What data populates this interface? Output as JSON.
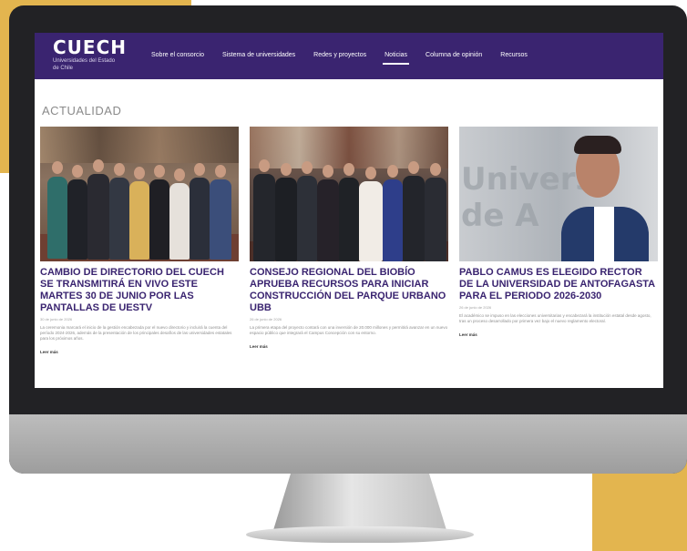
{
  "nav": {
    "logo": "CUECH",
    "logo_subtitle": "Universidades del Estado de Chile",
    "items": [
      {
        "label": "Sobre el consorcio"
      },
      {
        "label": "Sistema de universidades"
      },
      {
        "label": "Redes y proyectos"
      },
      {
        "label": "Noticias"
      },
      {
        "label": "Columna de opinión"
      },
      {
        "label": "Recursos"
      }
    ],
    "active_index": 3
  },
  "section_title": "ACTUALIDAD",
  "cards": [
    {
      "headline": "CAMBIO DE DIRECTORIO DEL CUECH SE TRANSMITIRÁ EN VIVO ESTE MARTES 30 DE JUNIO POR LAS PANTALLAS DE UESTV",
      "date": "30 de junio de 2026",
      "summary": "La ceremonia marcará el inicio de la gestión encabezada por el nuevo directorio y incluirá la cuenta del período 2024-2026, además de la presentación de los principales desafíos de las universidades estatales para los próximos años.",
      "more": "Leer más"
    },
    {
      "headline": "CONSEJO REGIONAL DEL BIOBÍO APRUEBA RECURSOS PARA INICIAR CONSTRUCCIÓN DEL PARQUE URBANO UBB",
      "date": "26 de junio de 2026",
      "summary": "La primera etapa del proyecto contará con una inversión de 20.000 millones y permitirá avanzar en un nuevo espacio público que integrará el Campus Concepción con su entorno.",
      "more": "Leer más"
    },
    {
      "headline": "PABLO CAMUS ES ELEGIDO RECTOR DE LA UNIVERSIDAD DE ANTOFAGASTA PARA EL PERIODO 2026-2030",
      "date": "26 de junio de 2026",
      "summary": "El académico se impuso en las elecciones universitarias y encabezará la institución estatal desde agosto, tras un proceso desarrollado por primera vez bajo el nuevo reglamento electoral.",
      "more": "Leer más",
      "photo_text": "Univers de A"
    }
  ],
  "colors": {
    "brand_purple": "#3a2470",
    "accent_gold": "#e3b54f"
  }
}
